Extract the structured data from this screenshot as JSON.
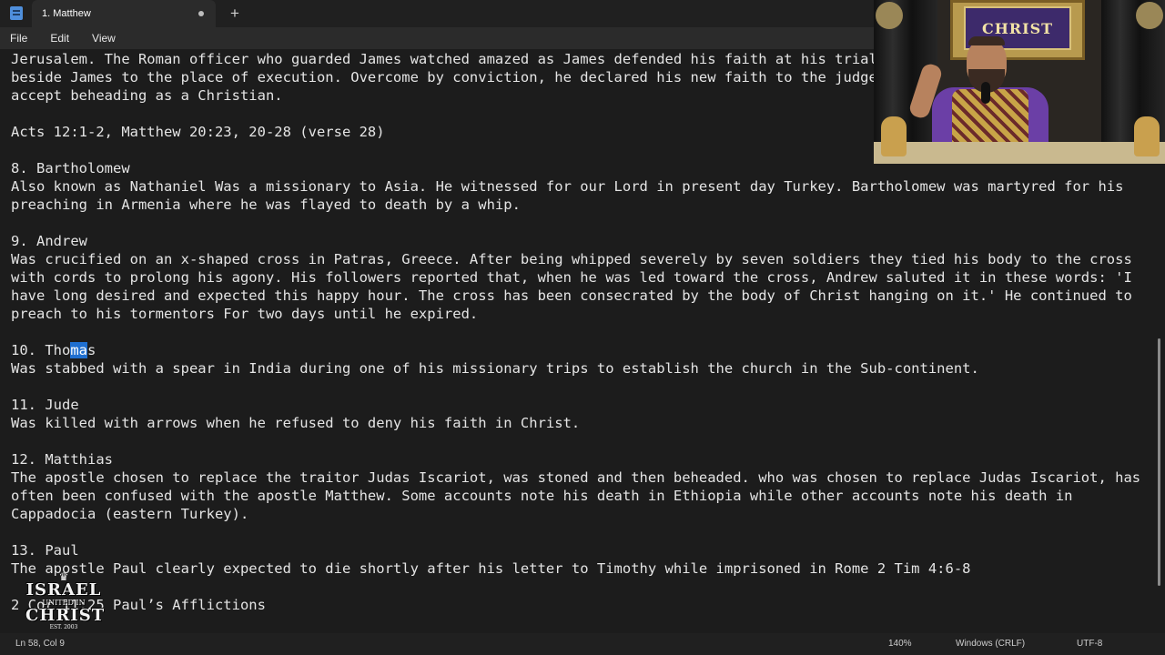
{
  "window": {
    "tab_title": "1. Matthew",
    "new_tab_symbol": "+",
    "app_icon": "notepad-icon"
  },
  "menu": [
    "File",
    "Edit",
    "View"
  ],
  "document": {
    "lines": [
      "Jerusalem. The Roman officer who guarded James watched amazed as James defended his faith at his trial",
      "beside James to the place of execution. Overcome by conviction, he declared his new faith to the judge",
      "accept beheading as a Christian.",
      "",
      "Acts 12:1-2, Matthew 20:23, 20-28 (verse 28)",
      "",
      "8. Bartholomew",
      "Also known as Nathaniel Was a missionary to Asia. He witnessed for our Lord in present day Turkey. Bartholomew was martyred for his",
      "preaching in Armenia where he was flayed to death by a whip.",
      "",
      "9. Andrew",
      "Was crucified on an x-shaped cross in Patras, Greece. After being whipped severely by seven soldiers they tied his body to the cross",
      "with cords to prolong his agony. His followers reported that, when he was led toward the cross, Andrew saluted it in these words: 'I",
      "have long desired and expected this happy hour. The cross has been consecrated by the body of Christ hanging on it.' He continued to",
      "preach to his tormentors For two days until he expired.",
      "",
      "10. Thomas",
      "Was stabbed with a spear in India during one of his missionary trips to establish the church in the Sub-continent.",
      "",
      "11. Jude",
      "Was killed with arrows when he refused to deny his faith in Christ.",
      "",
      "12. Matthias",
      "The apostle chosen to replace the traitor Judas Iscariot, was stoned and then beheaded. who was chosen to replace Judas Iscariot, has",
      "often been confused with the apostle Matthew. Some accounts note his death in Ethiopia while other accounts note his death in",
      "Cappadocia (eastern Turkey).",
      "",
      "13. Paul",
      "The apostle Paul clearly expected to die shortly after his letter to Timothy while imprisoned in Rome 2 Tim 4:6-8",
      "",
      "2 Cor 11:25 Paul’s Afflictions"
    ],
    "selection": {
      "before": "10. Tho",
      "selected": "ma",
      "after": "s"
    }
  },
  "status": {
    "position": "Ln 58, Col 9",
    "zoom": "140%",
    "line_ending": "Windows (CRLF)",
    "encoding": "UTF-8"
  },
  "overlay": {
    "sign_text": "CHRIST",
    "logo_lines": [
      "ISRAEL",
      "UNITED IN",
      "CHRIST",
      "EST. 2003"
    ]
  }
}
